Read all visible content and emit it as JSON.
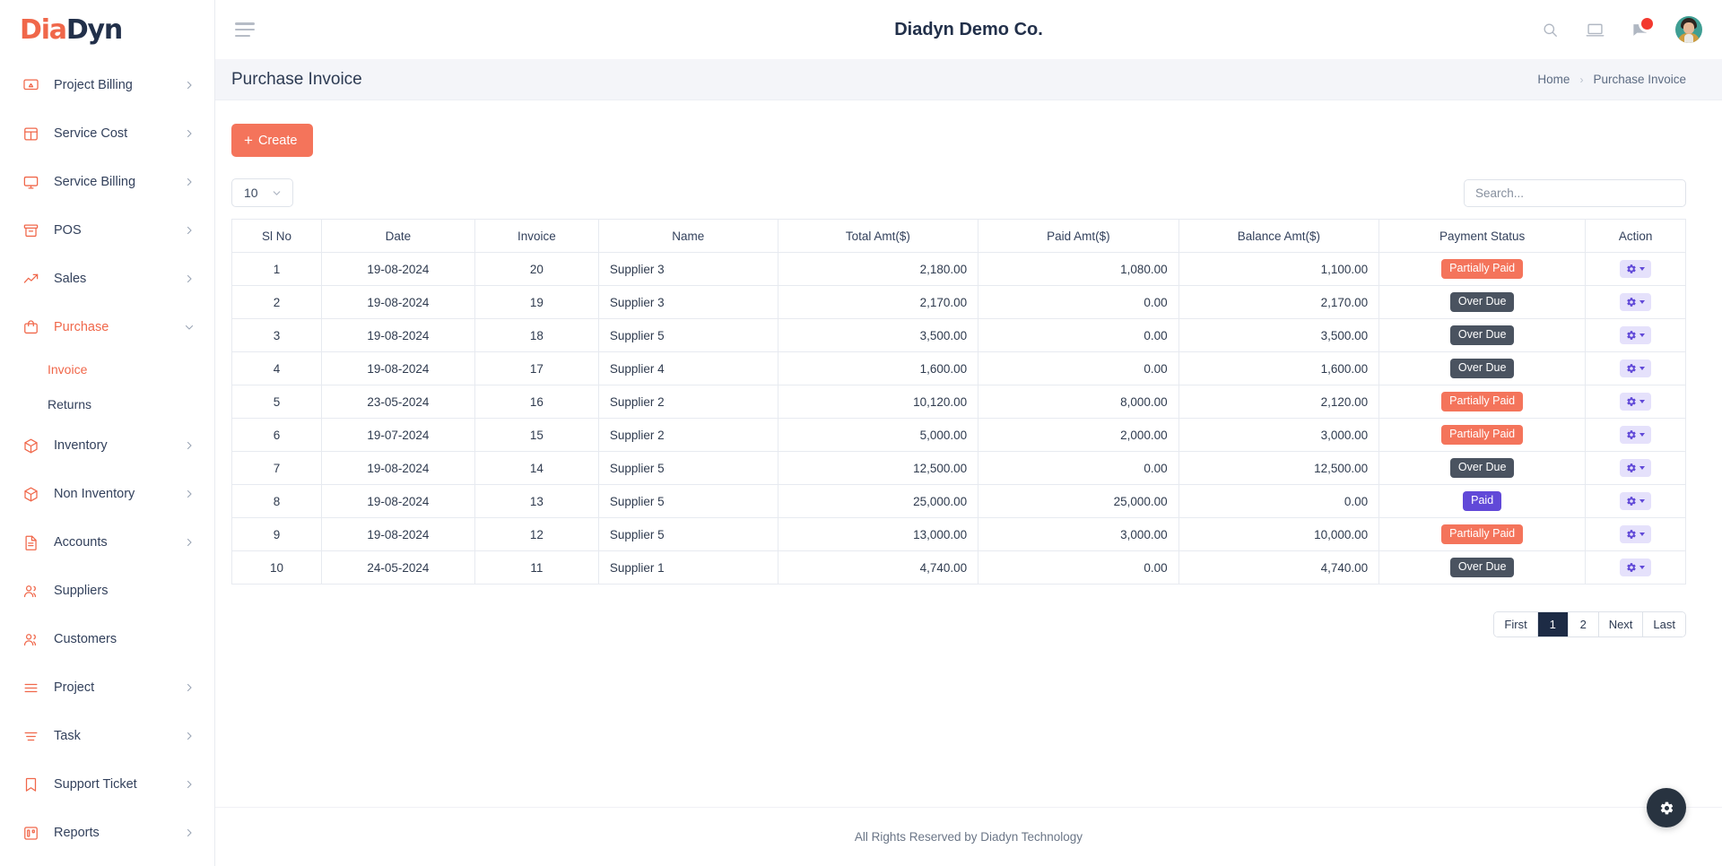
{
  "brand": {
    "part1": "Dia",
    "part2": "Dyn"
  },
  "topbar": {
    "company": "Diadyn Demo Co.",
    "icons": [
      "search-icon",
      "screen-icon",
      "message-icon",
      "avatar"
    ]
  },
  "sidebar": {
    "items": [
      {
        "label": "Project Billing",
        "icon": "project-billing-icon",
        "chevron": "right",
        "active": false
      },
      {
        "label": "Service Cost",
        "icon": "service-cost-icon",
        "chevron": "right",
        "active": false
      },
      {
        "label": "Service Billing",
        "icon": "service-billing-icon",
        "chevron": "right",
        "active": false
      },
      {
        "label": "POS",
        "icon": "pos-icon",
        "chevron": "right",
        "active": false
      },
      {
        "label": "Sales",
        "icon": "sales-icon",
        "chevron": "right",
        "active": false
      },
      {
        "label": "Purchase",
        "icon": "purchase-icon",
        "chevron": "down",
        "active": true
      },
      {
        "label": "Inventory",
        "icon": "inventory-icon",
        "chevron": "right",
        "active": false
      },
      {
        "label": "Non Inventory",
        "icon": "non-inventory-icon",
        "chevron": "right",
        "active": false
      },
      {
        "label": "Accounts",
        "icon": "accounts-icon",
        "chevron": "right",
        "active": false
      },
      {
        "label": "Suppliers",
        "icon": "suppliers-icon",
        "chevron": "none",
        "active": false
      },
      {
        "label": "Customers",
        "icon": "customers-icon",
        "chevron": "none",
        "active": false
      },
      {
        "label": "Project",
        "icon": "project-icon",
        "chevron": "right",
        "active": false
      },
      {
        "label": "Task",
        "icon": "task-icon",
        "chevron": "right",
        "active": false
      },
      {
        "label": "Support Ticket",
        "icon": "support-ticket-icon",
        "chevron": "right",
        "active": false
      },
      {
        "label": "Reports",
        "icon": "reports-icon",
        "chevron": "right",
        "active": false
      }
    ],
    "purchase_subitems": [
      {
        "label": "Invoice",
        "active": true
      },
      {
        "label": "Returns",
        "active": false
      }
    ]
  },
  "page": {
    "title": "Purchase Invoice",
    "breadcrumb": {
      "home": "Home",
      "separator": "›",
      "current": "Purchase Invoice"
    }
  },
  "toolbar": {
    "create_label": "Create",
    "create_plus": "+",
    "page_length": "10",
    "search_placeholder": "Search..."
  },
  "table": {
    "columns": [
      "Sl No",
      "Date",
      "Invoice",
      "Name",
      "Total Amt($)",
      "Paid Amt($)",
      "Balance Amt($)",
      "Payment Status",
      "Action"
    ],
    "rows": [
      {
        "sl": "1",
        "date": "19-08-2024",
        "invoice": "20",
        "name": "Supplier 3",
        "total": "2,180.00",
        "paid": "1,080.00",
        "balance": "1,100.00",
        "status": "Partially Paid",
        "status_kind": "partial"
      },
      {
        "sl": "2",
        "date": "19-08-2024",
        "invoice": "19",
        "name": "Supplier 3",
        "total": "2,170.00",
        "paid": "0.00",
        "balance": "2,170.00",
        "status": "Over Due",
        "status_kind": "overdue"
      },
      {
        "sl": "3",
        "date": "19-08-2024",
        "invoice": "18",
        "name": "Supplier 5",
        "total": "3,500.00",
        "paid": "0.00",
        "balance": "3,500.00",
        "status": "Over Due",
        "status_kind": "overdue"
      },
      {
        "sl": "4",
        "date": "19-08-2024",
        "invoice": "17",
        "name": "Supplier 4",
        "total": "1,600.00",
        "paid": "0.00",
        "balance": "1,600.00",
        "status": "Over Due",
        "status_kind": "overdue"
      },
      {
        "sl": "5",
        "date": "23-05-2024",
        "invoice": "16",
        "name": "Supplier 2",
        "total": "10,120.00",
        "paid": "8,000.00",
        "balance": "2,120.00",
        "status": "Partially Paid",
        "status_kind": "partial"
      },
      {
        "sl": "6",
        "date": "19-07-2024",
        "invoice": "15",
        "name": "Supplier 2",
        "total": "5,000.00",
        "paid": "2,000.00",
        "balance": "3,000.00",
        "status": "Partially Paid",
        "status_kind": "partial"
      },
      {
        "sl": "7",
        "date": "19-08-2024",
        "invoice": "14",
        "name": "Supplier 5",
        "total": "12,500.00",
        "paid": "0.00",
        "balance": "12,500.00",
        "status": "Over Due",
        "status_kind": "overdue"
      },
      {
        "sl": "8",
        "date": "19-08-2024",
        "invoice": "13",
        "name": "Supplier 5",
        "total": "25,000.00",
        "paid": "25,000.00",
        "balance": "0.00",
        "status": "Paid",
        "status_kind": "paid"
      },
      {
        "sl": "9",
        "date": "19-08-2024",
        "invoice": "12",
        "name": "Supplier 5",
        "total": "13,000.00",
        "paid": "3,000.00",
        "balance": "10,000.00",
        "status": "Partially Paid",
        "status_kind": "partial"
      },
      {
        "sl": "10",
        "date": "24-05-2024",
        "invoice": "11",
        "name": "Supplier 1",
        "total": "4,740.00",
        "paid": "0.00",
        "balance": "4,740.00",
        "status": "Over Due",
        "status_kind": "overdue"
      }
    ]
  },
  "pagination": {
    "buttons": [
      {
        "label": "First",
        "active": false
      },
      {
        "label": "1",
        "active": true
      },
      {
        "label": "2",
        "active": false
      },
      {
        "label": "Next",
        "active": false
      },
      {
        "label": "Last",
        "active": false
      }
    ]
  },
  "footer": {
    "text": "All Rights Reserved by Diadyn Technology"
  },
  "fab": {
    "icon": "gear-icon"
  },
  "colors": {
    "accent": "#f4745b",
    "brand_dark": "#22304a",
    "status_partial": "#f4745b",
    "status_overdue": "#4a5360",
    "status_paid": "#6149d8",
    "action_bg": "#e5e1fb",
    "pager_active": "#1d2b45",
    "notification": "#f3392f"
  }
}
